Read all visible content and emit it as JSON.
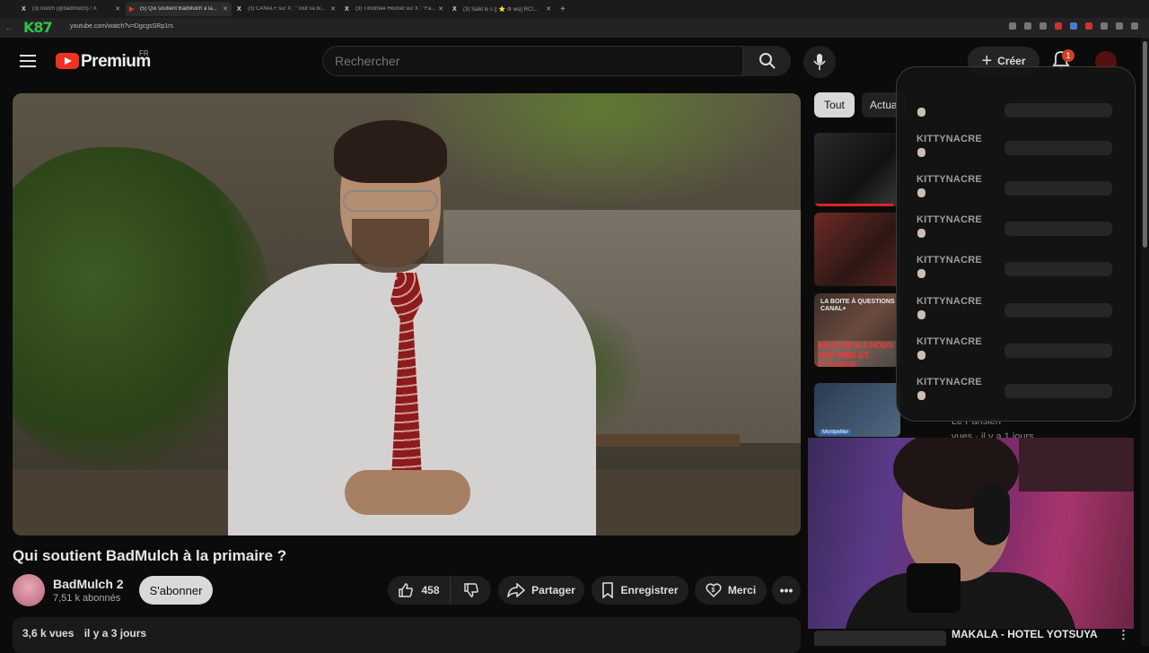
{
  "browser": {
    "tabs": [
      {
        "icon": "X",
        "title": "(3) mulch (@badmulch) / X",
        "active": false
      },
      {
        "icon": "YT",
        "title": "(5) Qui soutient BadMulch à la...",
        "active": true
      },
      {
        "icon": "X",
        "title": "(3) CANAL+ sur X : \"Tout va bi...",
        "active": false
      },
      {
        "icon": "X",
        "title": "(3) Timothée Hochet sur X : \"Fa...",
        "active": false
      },
      {
        "icon": "X",
        "title": "(3) Salkl le s || ⭐ ⚙ ws|| RC!...",
        "active": false
      }
    ],
    "url": "youtube.com/watch?v=DgcgsSRp1rs",
    "overlay_logo": "K87"
  },
  "header": {
    "brand": "Premium",
    "region": "FR",
    "search_placeholder": "Rechercher",
    "create_label": "Créer",
    "notification_count": "1"
  },
  "video": {
    "title": "Qui soutient BadMulch à la primaire ?",
    "channel": "BadMulch 2",
    "subscribers": "7,51 k abonnés",
    "subscribe_label": "S'abonner",
    "likes": "458",
    "share_label": "Partager",
    "save_label": "Enregistrer",
    "thanks_label": "Merci",
    "views": "3,6 k vues",
    "age": "il y a 3 jours"
  },
  "sidebar": {
    "chips": [
      "Tout",
      "Actua"
    ],
    "thumb3_text": "LA BOITE À QUESTIONS CANAL+",
    "thumb3_big": "BEST-OF ILS NOUS ONT RIRE ET PLEURER",
    "thumb4_tag": "Montpellier",
    "meta_lines": [
      "Le Parisien",
      "vues · il y a 1 jours"
    ]
  },
  "dropdown": {
    "items": [
      "",
      "KITTYNACRE",
      "KITTYNACRE",
      "KITTYNACRE",
      "KITTYNACRE",
      "KITTYNACRE",
      "KITTYNACRE",
      "KITTYNACRE"
    ]
  },
  "now_playing": {
    "title": "MAKALA - HOTEL YOTSUYA"
  }
}
